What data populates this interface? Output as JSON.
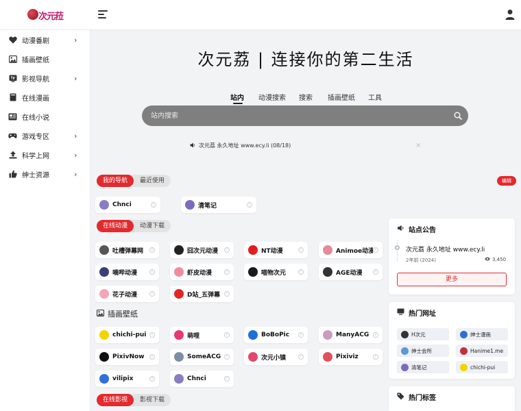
{
  "header": {
    "logo_text": "次元菈"
  },
  "sidebar": {
    "items": [
      {
        "label": "动漫番剧",
        "icon": "heart-icon",
        "arrow": "›"
      },
      {
        "label": "插画壁纸",
        "icon": "image-icon",
        "arrow": ""
      },
      {
        "label": "影视导航",
        "icon": "tv-icon",
        "arrow": "›"
      },
      {
        "label": "在线漫画",
        "icon": "book-icon",
        "arrow": ""
      },
      {
        "label": "在线小说",
        "icon": "newspaper-icon",
        "arrow": ""
      },
      {
        "label": "游戏专区",
        "icon": "gamepad-icon",
        "arrow": "›"
      },
      {
        "label": "科学上网",
        "icon": "upload-icon",
        "arrow": "›"
      },
      {
        "label": "绅士资源",
        "icon": "thumbs-up-icon",
        "arrow": "›"
      }
    ]
  },
  "hero": {
    "title": "次元荔 | 连接你的第二生活"
  },
  "search": {
    "tabs": [
      "站内",
      "动漫搜索",
      "搜索",
      "插画壁纸",
      "工具"
    ],
    "placeholder": "站内搜索"
  },
  "notice": {
    "text": "次元荔 永久地址 www.ecy.li (08/18)",
    "close": "×"
  },
  "nav_tabs": {
    "items": [
      "我的导航",
      "最近使用"
    ],
    "edit_label": "编辑"
  },
  "my_nav": [
    {
      "label": "Chnci",
      "color": "#8a7cc4"
    },
    {
      "label": "清笔记",
      "color": "#7c6cc0"
    }
  ],
  "anime_tabs": [
    "在线动漫",
    "动漫下载"
  ],
  "anime": [
    {
      "label": "吐槽弹幕网",
      "color": "#555555"
    },
    {
      "label": "囧次元动漫",
      "color": "#222222"
    },
    {
      "label": "NT动漫",
      "color": "#e02020"
    },
    {
      "label": "Animoe动漫",
      "color": "#e58a9a"
    },
    {
      "label": "嘀哔动漫",
      "color": "#3a3f7a"
    },
    {
      "label": "虾皮动漫",
      "color": "#f08ca0"
    },
    {
      "label": "喵物次元",
      "color": "#1a1a1a"
    },
    {
      "label": "AGE动漫",
      "color": "#333333"
    },
    {
      "label": "花子动漫",
      "color": "#f4a6b8"
    },
    {
      "label": "D站_五弹幕",
      "color": "#e02626"
    }
  ],
  "illust": {
    "title": "插画壁纸",
    "items": [
      {
        "label": "chichi-pui",
        "color": "#f2d400"
      },
      {
        "label": "萌哩",
        "color": "#e8386d"
      },
      {
        "label": "BoBoPic",
        "color": "#1e6fd9"
      },
      {
        "label": "ManyACG",
        "color": "#c89cc0"
      },
      {
        "label": "PixivNow",
        "color": "#111111"
      },
      {
        "label": "SomeACG",
        "color": "#7c8fa6"
      },
      {
        "label": "次元小镇",
        "color": "#e04a6a"
      },
      {
        "label": "Pixiviz",
        "color": "#e0505a"
      },
      {
        "label": "vilipix",
        "color": "#2f6fe0"
      },
      {
        "label": "Chnci",
        "color": "#8a7cc4"
      }
    ]
  },
  "video_tabs": [
    "在线影视",
    "影视下载"
  ],
  "announcement": {
    "title": "站点公告",
    "item_title": "次元荔 永久地址 www.ecy.li",
    "time": "2年前 (2024)",
    "views": "3,450",
    "more_label": "更多"
  },
  "hot_sites": {
    "title": "热门网址",
    "items": [
      {
        "label": "H次元",
        "color": "#333333"
      },
      {
        "label": "绅士漫画",
        "color": "#2f6fd0"
      },
      {
        "label": "绅士会所",
        "color": "#5a9ad8"
      },
      {
        "label": "Hanime1.me",
        "color": "#c0303a"
      },
      {
        "label": "清笔记",
        "color": "#7c6cc0"
      },
      {
        "label": "chichi-pui",
        "color": "#f2d400"
      }
    ]
  },
  "hot_tags": {
    "title": "热门标签"
  },
  "colors": {
    "accent": "#e22a2f",
    "search_bg": "#7f7f7f"
  }
}
